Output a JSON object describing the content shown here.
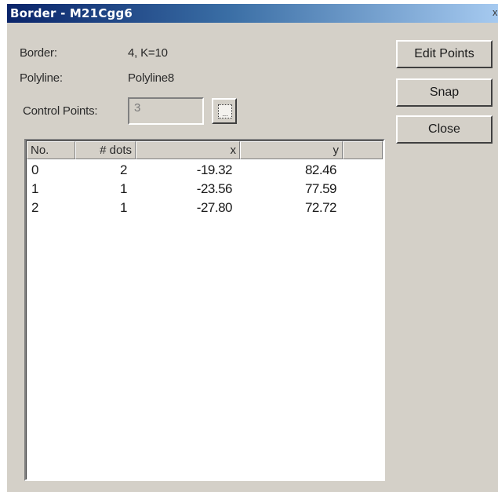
{
  "window": {
    "title": "Border - M21Cgg6",
    "close_glyph": "x"
  },
  "fields": {
    "border_label": "Border:",
    "border_value": "4,  K=10",
    "polyline_label": "Polyline:",
    "polyline_value": "Polyline8",
    "control_points_label": "Control Points:",
    "control_points_value": "3",
    "browse_glyph": "..."
  },
  "buttons": {
    "edit_points": "Edit Points",
    "snap": "Snap",
    "close": "Close"
  },
  "table": {
    "columns": [
      {
        "label": "No."
      },
      {
        "label": "# dots"
      },
      {
        "label": "x"
      },
      {
        "label": "y"
      },
      {
        "label": ""
      }
    ],
    "rows": [
      {
        "no": "0",
        "dots": "2",
        "x": "-19.32",
        "y": "82.46"
      },
      {
        "no": "1",
        "dots": "1",
        "x": "-23.56",
        "y": "77.59"
      },
      {
        "no": "2",
        "dots": "1",
        "x": "-27.80",
        "y": "72.72"
      }
    ]
  },
  "colors": {
    "face": "#d4d0c8",
    "title_start": "#0a246a",
    "title_end": "#a6caf0",
    "list_bg": "#ffffff"
  },
  "icons": {
    "browse": "ellipsis-button-icon",
    "close": "close-icon"
  }
}
